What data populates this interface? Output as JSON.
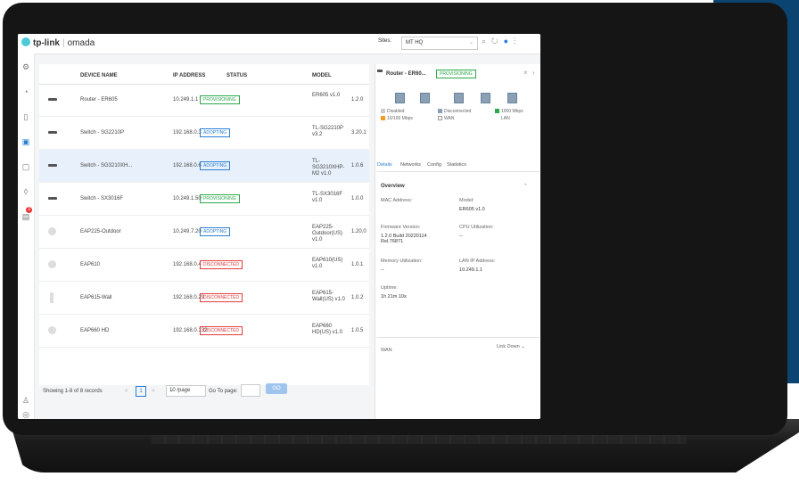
{
  "app": {
    "logo_text": "tp-link",
    "product": "omada"
  },
  "topbar": {
    "sites_label": "Sites:",
    "site_value": "MT HQ",
    "icons": [
      "chevron-down-icon",
      "search-icon",
      "refresh-icon",
      "user-icon",
      "more-icon"
    ]
  },
  "nav": {
    "icons": [
      "dashboard-icon",
      "statistics-icon",
      "map-icon",
      "devices-icon",
      "clients-icon",
      "location-icon",
      "alerts-icon",
      "settings-icon",
      "logs-icon"
    ],
    "alert_count": "3"
  },
  "table": {
    "headers": {
      "device": "DEVICE NAME",
      "ip": "IP ADDRESS",
      "status": "STATUS",
      "model": "MODEL"
    },
    "rows": [
      {
        "name": "Router - ER605",
        "ip": "10.249.1.1",
        "status": "PROVISIONING",
        "status_kind": "prov",
        "model": "ER605 v1.0",
        "version": "1.2.0"
      },
      {
        "name": "Switch - SG2210P",
        "ip": "192.168.0.3",
        "status": "ADOPTING",
        "status_kind": "adopt",
        "model": "TL-SG2210P v3.2",
        "version": "3.20.1"
      },
      {
        "name": "Switch - SG3210XH...",
        "ip": "192.168.0.6",
        "status": "ADOPTING",
        "status_kind": "adopt",
        "model": "TL-SG3210XHP-M2 v1.0",
        "version": "1.0.6"
      },
      {
        "name": "Switch - SX3016F",
        "ip": "10.249.1.50",
        "status": "PROVISIONING",
        "status_kind": "prov",
        "model": "TL-SX3016F v1.0",
        "version": "1.0.0"
      },
      {
        "name": "EAP225-Outdoor",
        "ip": "10.249.7.20",
        "status": "ADOPTING",
        "status_kind": "adopt",
        "model": "EAP225-Outdoor(US) v1.0",
        "version": "1.20.0"
      },
      {
        "name": "EAP610",
        "ip": "192.168.0.4",
        "status": "DISCONNECTED",
        "status_kind": "disc",
        "model": "EAP610(US) v1.0",
        "version": "1.0.1"
      },
      {
        "name": "EAP615-Wall",
        "ip": "192.168.0.29",
        "status": "DISCONNECTED",
        "status_kind": "disc",
        "model": "EAP615-Wall(US) v1.0",
        "version": "1.0.2"
      },
      {
        "name": "EAP660 HD",
        "ip": "192.168.0.132",
        "status": "DISCONNECTED",
        "status_kind": "disc",
        "model": "EAP660 HD(US) v1.0",
        "version": "1.0.5"
      }
    ]
  },
  "pager": {
    "summary": "Showing 1-8 of 8 records",
    "prev": "<",
    "page": "1",
    "next": ">",
    "per_page": "10 /page",
    "goto_label": "Go To page:",
    "go": "GO"
  },
  "panel": {
    "title": "Router - ER60...",
    "status": "PROVISIONING",
    "legend": {
      "disabled": "Disabled",
      "disconnected": "Disconnected",
      "g1000": "1000 Mbps",
      "m10100": "10/100 Mbps",
      "wan": "WAN",
      "lan": "LAN"
    },
    "tabs": [
      "Details",
      "Networks",
      "Config",
      "Statistics"
    ],
    "overview": {
      "title": "Overview",
      "mac_label": "MAC Address:",
      "model_label": "Model:",
      "model_value": "ER605 v1.0",
      "fw_label": "Firmware Version:",
      "fw_value": "1.2.0 Build 20220114 Rel.76871",
      "cpu_label": "CPU Utilization:",
      "cpu_value": "--",
      "mem_label": "Memory Utilization:",
      "mem_value": "--",
      "lanip_label": "LAN IP Address:",
      "lanip_value": "10.249.1.1",
      "uptime_label": "Uptime:",
      "uptime_value": "1h 21m 10s"
    },
    "wan_label": "WAN",
    "wan_status": "Link Down"
  },
  "colors": {
    "promo_bg": "#0b4470",
    "accent": "#2a7fd4",
    "prov": "#2aa84a",
    "disc": "#e23b3b"
  }
}
